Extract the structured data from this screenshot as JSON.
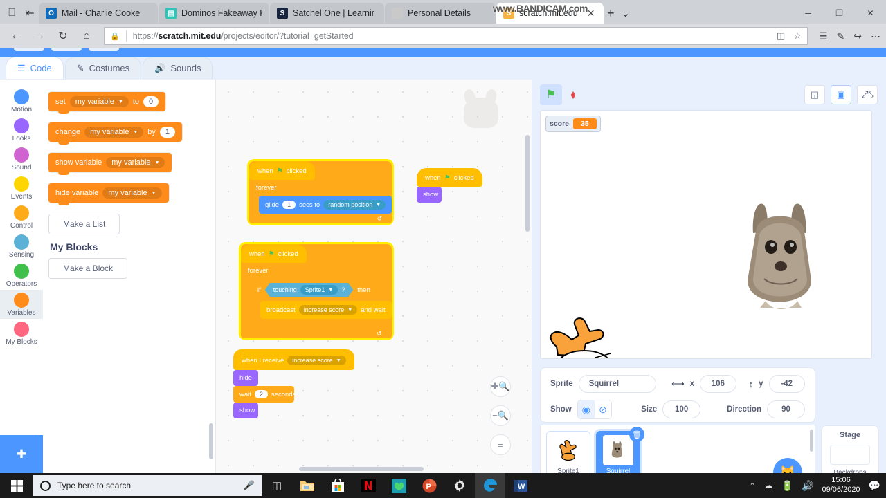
{
  "browser": {
    "tabs": [
      {
        "title": "Mail - Charlie Cooke",
        "favicon": "outlook-icon",
        "fav_color": "#0f6cbd",
        "fav_text": "O",
        "active": false
      },
      {
        "title": "Dominos Fakeaway F",
        "favicon": "dominos-icon",
        "fav_color": "#2ec4b6",
        "fav_text": "▤",
        "active": false
      },
      {
        "title": "Satchel One | Learnir",
        "favicon": "satchel-icon",
        "fav_color": "#16243e",
        "fav_text": "S",
        "active": false
      },
      {
        "title": "Personal Details",
        "favicon": "bandicam-icon",
        "fav_color": "#c9c9c9",
        "fav_text": "",
        "active": false
      },
      {
        "title": "scratch.mit.edu",
        "favicon": "scratch-icon",
        "fav_color": "#f5b342",
        "fav_text": "S",
        "active": true
      }
    ],
    "tab_close_label": "✕",
    "new_tab_label": "+",
    "tab_list_label": "⌄",
    "window_minimize": "─",
    "window_restore": "❐",
    "window_close": "✕",
    "nav": {
      "back": "←",
      "forward": "→",
      "reload": "↻",
      "home": "⌂"
    },
    "omnibox": {
      "lock_icon": "lock-icon",
      "url_prefix": "https://",
      "url_domain": "scratch.mit.edu",
      "url_path": "/projects/editor/?tutorial=getStarted",
      "reading_view": "◫",
      "favorite": "☆"
    },
    "toolbar_right": [
      "☰",
      "✎",
      "↪",
      "⋯"
    ],
    "watermark": "www.BANDICAM.com"
  },
  "scratch": {
    "editor_tabs": [
      {
        "label": "Code",
        "icon": "code-icon",
        "active": true
      },
      {
        "label": "Costumes",
        "icon": "brush-icon",
        "active": false
      },
      {
        "label": "Sounds",
        "icon": "speaker-icon",
        "active": false
      }
    ],
    "categories": [
      {
        "name": "Motion",
        "color": "#4c97ff",
        "selected": false
      },
      {
        "name": "Looks",
        "color": "#9966ff",
        "selected": false
      },
      {
        "name": "Sound",
        "color": "#cf63cf",
        "selected": false
      },
      {
        "name": "Events",
        "color": "#ffd500",
        "selected": false
      },
      {
        "name": "Control",
        "color": "#ffab19",
        "selected": false
      },
      {
        "name": "Sensing",
        "color": "#5cb1d6",
        "selected": false
      },
      {
        "name": "Operators",
        "color": "#40bf4a",
        "selected": false
      },
      {
        "name": "Variables",
        "color": "#ff8c1a",
        "selected": true
      },
      {
        "name": "My Blocks",
        "color": "#ff6680",
        "selected": false
      }
    ],
    "add_extension_icon": "add-extension-icon",
    "palette": {
      "blocks": [
        {
          "id": "set-var",
          "parts": [
            "set"
          ],
          "dropdown": "my variable",
          "tail": "to",
          "value": "0"
        },
        {
          "id": "change-var",
          "parts": [
            "change"
          ],
          "dropdown": "my variable",
          "tail": "by",
          "value": "1"
        },
        {
          "id": "show-var",
          "parts": [
            "show variable"
          ],
          "dropdown": "my variable",
          "tail": "",
          "value": ""
        },
        {
          "id": "hide-var",
          "parts": [
            "hide variable"
          ],
          "dropdown": "my variable",
          "tail": "",
          "value": ""
        }
      ],
      "make_list_label": "Make a List",
      "my_blocks_heading": "My Blocks",
      "make_block_label": "Make a Block"
    },
    "scripts": {
      "script1": {
        "hat_prefix": "when",
        "hat_suffix": "clicked",
        "loop": "forever",
        "glide": {
          "label": "glide",
          "secs": "1",
          "mid": "secs to",
          "target": "random position"
        },
        "running": true
      },
      "script2": {
        "hat_prefix": "when",
        "hat_suffix": "clicked",
        "show": "show"
      },
      "script3": {
        "hat_prefix": "when",
        "hat_suffix": "clicked",
        "loop": "forever",
        "if_label": "if",
        "touching_label": "touching",
        "touching_target": "Sprite1",
        "question": "?",
        "then_label": "then",
        "broadcast_label": "broadcast",
        "broadcast_msg": "increase score",
        "and_wait_label": "and wait",
        "running": true
      },
      "script4": {
        "receive_label": "when I receive",
        "receive_msg": "increase score",
        "hide": "hide",
        "wait_label": "wait",
        "wait_secs": "2",
        "seconds_label": "seconds",
        "show": "show"
      }
    },
    "zoom_controls": {
      "zoom_in": "zoom-in-icon",
      "zoom_out": "zoom-out-icon",
      "zoom_reset": "zoom-reset-icon"
    },
    "stage_controls": {
      "green_flag": "green-flag-icon",
      "stop": "stop-icon",
      "small_stage": "small-stage-icon",
      "large_stage": "large-stage-icon",
      "fullscreen": "fullscreen-icon"
    },
    "monitor": {
      "label": "score",
      "value": "35"
    },
    "sprite_info": {
      "sprite_label": "Sprite",
      "sprite_name": "Squirrel",
      "x_label": "x",
      "x_value": "106",
      "y_label": "y",
      "y_value": "-42",
      "show_label": "Show",
      "size_label": "Size",
      "size_value": "100",
      "direction_label": "Direction",
      "direction_value": "90",
      "show_on_icon": "eye-icon",
      "show_off_icon": "eye-slash-icon"
    },
    "sprites": [
      {
        "name": "Sprite1",
        "selected": false,
        "thumb": "cat-icon"
      },
      {
        "name": "Squirrel",
        "selected": true,
        "thumb": "squirrel-icon"
      }
    ],
    "delete_badge_icon": "trash-icon",
    "add_sprite_icon": "add-sprite-icon",
    "stage_pane": {
      "title": "Stage",
      "backdrops_label": "Backdrops",
      "add_backdrop_icon": "add-backdrop-icon"
    }
  },
  "taskbar": {
    "start_icon": "windows-icon",
    "search_placeholder": "Type here to search",
    "mic_icon": "microphone-icon",
    "taskview_icon": "task-view-icon",
    "apps": [
      {
        "name": "file-explorer-icon",
        "active": false
      },
      {
        "name": "microsoft-store-icon",
        "active": false
      },
      {
        "name": "netflix-icon",
        "active": false
      },
      {
        "name": "teal-app-icon",
        "active": false
      },
      {
        "name": "powerpoint-icon",
        "active": false
      },
      {
        "name": "settings-icon",
        "active": false
      },
      {
        "name": "edge-icon",
        "active": true
      },
      {
        "name": "word-icon",
        "active": false
      }
    ],
    "tray": {
      "chevron": "⌃",
      "onedrive_icon": "onedrive-icon",
      "battery_icon": "battery-icon",
      "volume_icon": "volume-icon",
      "time": "15:06",
      "date": "09/06/2020",
      "notifications_icon": "notifications-icon"
    }
  }
}
